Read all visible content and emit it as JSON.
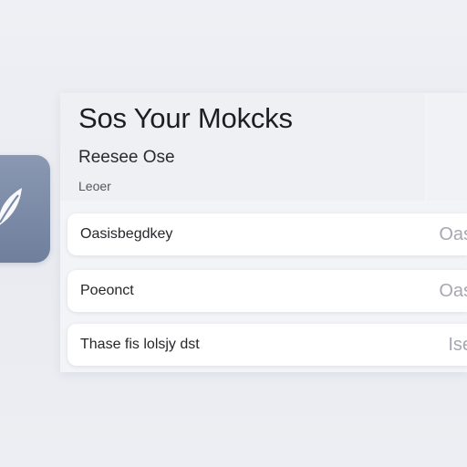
{
  "header": {
    "title": "Sos Your Mokcks",
    "subtitle": "Reesee Ose",
    "caption": "Leoer"
  },
  "rows": [
    {
      "label": "Oasisbegdkey",
      "value": "Oas"
    },
    {
      "label": "Poeonct",
      "value": "Oas"
    },
    {
      "label": "Thase fis lolsjy dst",
      "value": "Ise"
    }
  ],
  "colors": {
    "background": "#eef0f5",
    "app_icon": "#7b8aa6",
    "row_value": "#a6a8b0"
  },
  "icons": {
    "app_icon": "leaf-icon"
  }
}
